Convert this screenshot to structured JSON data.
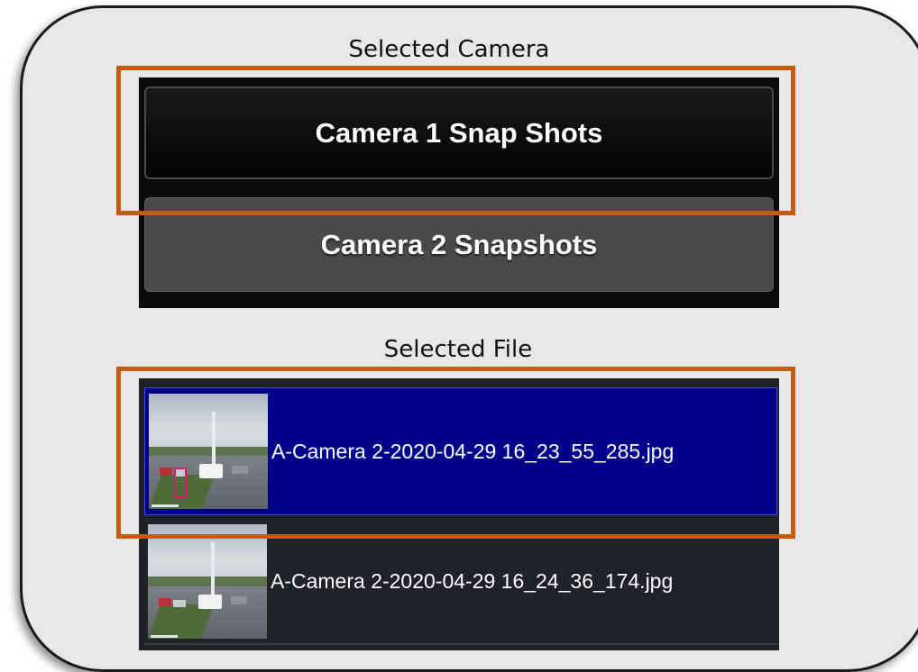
{
  "captions": {
    "selected_camera": "Selected Camera",
    "selected_file": "Selected File"
  },
  "camera_buttons": [
    {
      "label": "Camera 1 Snap Shots",
      "selected": true
    },
    {
      "label": "Camera 2 Snapshots",
      "selected": false
    }
  ],
  "files": [
    {
      "name": "A-Camera 2-2020-04-29 16_23_55_285.jpg",
      "selected": true
    },
    {
      "name": "A-Camera 2-2020-04-29 16_24_36_174.jpg",
      "selected": false
    }
  ],
  "colors": {
    "highlight": "#c55a11",
    "selected_row": "#00008b",
    "row": "#1f2227",
    "panel": "#e7e7e7"
  },
  "icons": [
    "thumbnail-image",
    "thumbnail-image"
  ]
}
